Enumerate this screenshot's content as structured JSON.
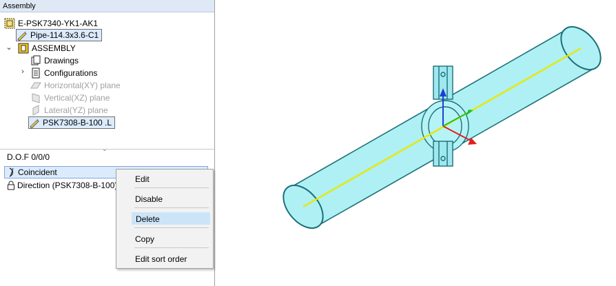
{
  "panel": {
    "title": "Assembly"
  },
  "tree": {
    "root": "E-PSK7340-YK1-AK1",
    "pipe": "Pipe-114.3x3.6-C1",
    "assembly": "ASSEMBLY",
    "drawings": "Drawings",
    "configurations": "Configurations",
    "plane_xy": "Horizontal(XY) plane",
    "plane_xz": "Vertical(XZ) plane",
    "plane_yz": "Lateral(YZ) plane",
    "part": "PSK7308-B-100 .L"
  },
  "dof": {
    "label": "D.O.F",
    "value": "0/0/0"
  },
  "constraints": [
    {
      "label": "Coincident"
    },
    {
      "label": "Direction (PSK7308-B-100)"
    }
  ],
  "context_menu": {
    "edit": "Edit",
    "disable": "Disable",
    "delete": "Delete",
    "copy": "Copy",
    "edit_sort_order": "Edit sort order"
  },
  "colors": {
    "pipe_fill": "#aef0f4",
    "pipe_edge": "#1b6f78",
    "axis_line": "#e8e800",
    "axis_up": "#1f3fd6",
    "axis_right": "#e02020",
    "axis_depth": "#22c022",
    "menu_highlight": "#cce4f7"
  }
}
